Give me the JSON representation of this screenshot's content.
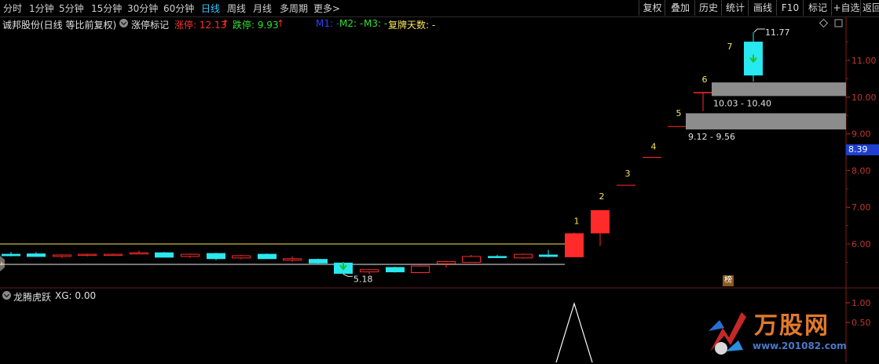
{
  "toolbar": {
    "periods": [
      "分时",
      "1分钟",
      "5分钟",
      "15分钟",
      "30分钟",
      "60分钟",
      "日线",
      "周线",
      "月线",
      "多周期",
      "更多>"
    ],
    "active_period": "日线",
    "buttons": [
      "复权",
      "叠加",
      "历史",
      "统计",
      "画线",
      "F10",
      "标记",
      "+自选",
      "返回"
    ]
  },
  "title_row": {
    "stock": "诚邦股份(日线 等比前复权)",
    "indicator": "涨停标记",
    "limit_up": "涨停: 12.13",
    "limit_down": "跌停: 9.93",
    "m1": "M1: -",
    "m2": "M2: -",
    "m3": "M3: -",
    "resume_days": "复牌天数: -"
  },
  "price_axis": {
    "ticks": [
      "11.00",
      "10.00",
      "9.00",
      "8.00",
      "7.00",
      "6.00"
    ],
    "current_price": "8.39"
  },
  "annotations": {
    "high_label": "11.77",
    "low_label": "5.18",
    "gap_upper": "10.03 - 10.40",
    "gap_lower": "9.12 - 9.56",
    "limit_numbers": [
      "1",
      "2",
      "3",
      "4",
      "5",
      "6",
      "7"
    ],
    "bang_badge": "榜"
  },
  "lower_panel": {
    "indicator": "龙腾虎跃",
    "xg": "XG: 0.00",
    "ticks": [
      "1.00",
      "0.50"
    ]
  },
  "watermark": {
    "logo_text": "万股网",
    "url": "www.201082.com"
  },
  "colors": {
    "up": "#ff2a2a",
    "down": "#28e8f0",
    "active": "#39c6ff",
    "limit_up": "#ff3030",
    "limit_down": "#2ee02e",
    "yellow": "#f5e25a",
    "gray_bar": "#8c8c8c"
  },
  "chart_data": {
    "type": "candlestick",
    "series": [
      {
        "o": 5.72,
        "h": 5.78,
        "l": 5.66,
        "c": 5.68
      },
      {
        "o": 5.73,
        "h": 5.78,
        "l": 5.65,
        "c": 5.66
      },
      {
        "o": 5.66,
        "h": 5.72,
        "l": 5.62,
        "c": 5.7
      },
      {
        "o": 5.7,
        "h": 5.74,
        "l": 5.66,
        "c": 5.72
      },
      {
        "o": 5.7,
        "h": 5.74,
        "l": 5.68,
        "c": 5.72
      },
      {
        "o": 5.74,
        "h": 5.82,
        "l": 5.72,
        "c": 5.76
      },
      {
        "o": 5.76,
        "h": 5.78,
        "l": 5.64,
        "c": 5.64
      },
      {
        "o": 5.66,
        "h": 5.74,
        "l": 5.62,
        "c": 5.72
      },
      {
        "o": 5.74,
        "h": 5.76,
        "l": 5.56,
        "c": 5.6
      },
      {
        "o": 5.62,
        "h": 5.7,
        "l": 5.58,
        "c": 5.68
      },
      {
        "o": 5.72,
        "h": 5.74,
        "l": 5.6,
        "c": 5.6
      },
      {
        "o": 5.56,
        "h": 5.66,
        "l": 5.52,
        "c": 5.6
      },
      {
        "o": 5.58,
        "h": 5.6,
        "l": 5.46,
        "c": 5.48
      },
      {
        "o": 5.48,
        "h": 5.5,
        "l": 5.18,
        "c": 5.2
      },
      {
        "o": 5.24,
        "h": 5.32,
        "l": 5.18,
        "c": 5.3
      },
      {
        "o": 5.36,
        "h": 5.38,
        "l": 5.22,
        "c": 5.24
      },
      {
        "o": 5.22,
        "h": 5.42,
        "l": 5.22,
        "c": 5.4
      },
      {
        "o": 5.46,
        "h": 5.54,
        "l": 5.36,
        "c": 5.52
      },
      {
        "o": 5.5,
        "h": 5.7,
        "l": 5.5,
        "c": 5.66
      },
      {
        "o": 5.66,
        "h": 5.7,
        "l": 5.62,
        "c": 5.64
      },
      {
        "o": 5.62,
        "h": 5.74,
        "l": 5.6,
        "c": 5.72
      },
      {
        "o": 5.7,
        "h": 5.84,
        "l": 5.64,
        "c": 5.66
      },
      {
        "o": 5.65,
        "h": 6.31,
        "l": 5.65,
        "c": 6.28
      },
      {
        "o": 6.3,
        "h": 6.91,
        "l": 5.95,
        "c": 6.91
      },
      {
        "o": 7.6,
        "h": 7.6,
        "l": 7.6,
        "c": 7.6
      },
      {
        "o": 8.36,
        "h": 8.36,
        "l": 8.36,
        "c": 8.36
      },
      {
        "o": 9.2,
        "h": 9.2,
        "l": 9.2,
        "c": 9.2
      },
      {
        "o": 10.12,
        "h": 10.12,
        "l": 9.62,
        "c": 10.12
      },
      {
        "o": 11.5,
        "h": 11.77,
        "l": 10.42,
        "c": 10.6
      }
    ],
    "ylim": [
      5.0,
      12.2
    ]
  }
}
